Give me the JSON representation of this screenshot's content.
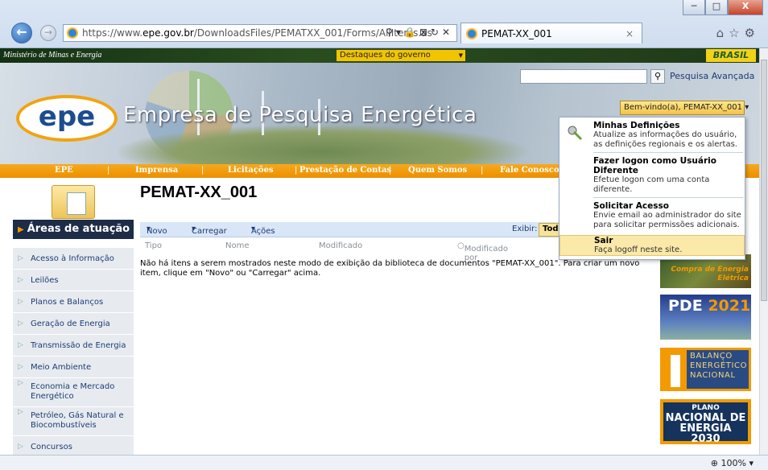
{
  "browser": {
    "url_prefix": "https://www.",
    "url_host": "epe.gov.br",
    "url_path": "/DownloadsFiles/PEMATXX_001/Forms/AllItems.as",
    "tab_title": "PEMAT-XX_001",
    "window_controls": [
      "─",
      "□",
      "X"
    ],
    "zoom": "100%"
  },
  "govbar": {
    "ministry": "Ministério de Minas e Energia",
    "highlights": "Destaques do governo",
    "brand": "BRASIL"
  },
  "banner": {
    "logo_text": "epe",
    "title": "Empresa de Pesquisa Energética",
    "search_placeholder": "",
    "advanced_search": "Pesquisa Avançada",
    "welcome": "Bem-vindo(a), PEMAT-XX_001"
  },
  "topnav": [
    "EPE",
    "Imprensa",
    "Licitações",
    "Prestação de Contas",
    "Quem Somos",
    "Fale Conosco"
  ],
  "page": {
    "title": "PEMAT-XX_001"
  },
  "leftnav": {
    "heading": "Áreas de atuação",
    "items": [
      "Acesso à Informação",
      "Leilões",
      "Planos e Balanços",
      "Geração de Energia",
      "Transmissão de Energia",
      "Meio Ambiente",
      "Economia e Mercado Energético",
      "Petróleo, Gás Natural e Biocombustíveis",
      "Concursos"
    ]
  },
  "library": {
    "toolbar": {
      "new": "Novo",
      "upload": "Carregar",
      "actions": "Ações",
      "view_label": "Exibir:",
      "view_value": "Tod"
    },
    "columns": [
      "Tipo",
      "Nome",
      "Modificado",
      "Modificado por"
    ],
    "empty_message": "Não há itens a serem mostrados neste modo de exibição da biblioteca de documentos \"PEMAT-XX_001\". Para criar um novo item, clique em \"Novo\" ou \"Carregar\" acima."
  },
  "promos": {
    "p1": "Compra de Energia Elétrica",
    "p2_label": "PDE",
    "p2_year": "2021",
    "p3": "BALANÇO ENERGÉTICO NACIONAL",
    "p4_top": "PLANO",
    "p4_mid": "NACIONAL DE ENERGIA",
    "p4_year": "2030"
  },
  "user_menu": {
    "items": [
      {
        "title": "Minhas Definições",
        "desc": "Atualize as informações do usuário, as definições regionais e os alertas."
      },
      {
        "title": "Fazer logon como Usuário Diferente",
        "desc": "Efetue logon com uma conta diferente."
      },
      {
        "title": "Solicitar Acesso",
        "desc": "Envie email ao administrador do site para solicitar permissões adicionais."
      },
      {
        "title": "Sair",
        "desc": "Faça logoff neste site."
      }
    ]
  }
}
